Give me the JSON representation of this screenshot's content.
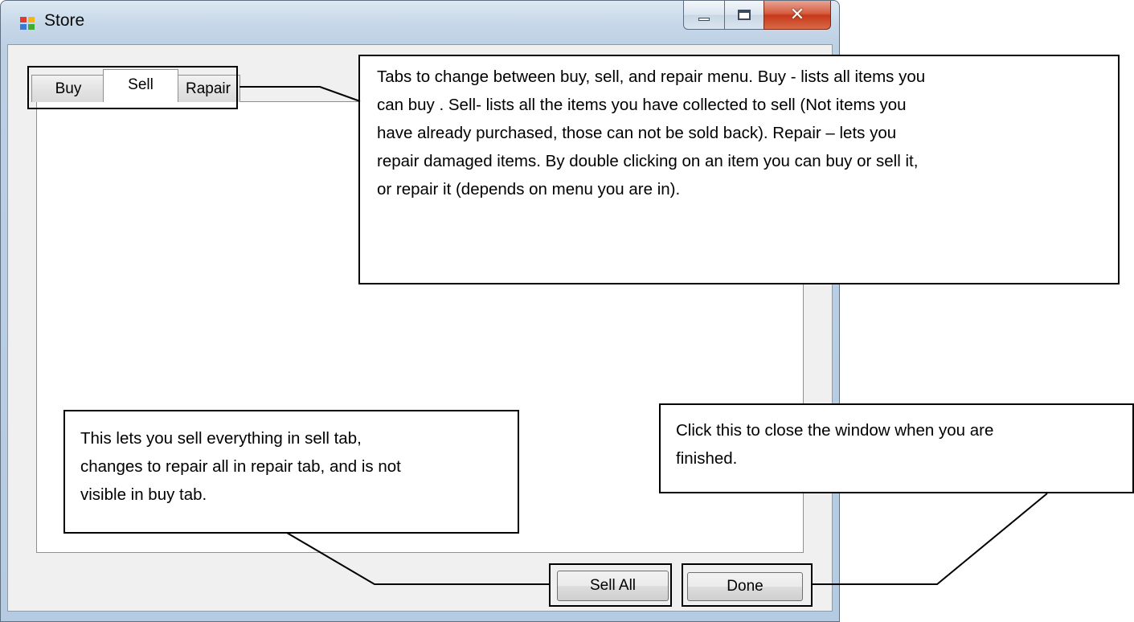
{
  "window": {
    "title": "Store",
    "icon": "store-app-icon",
    "caption_buttons": [
      "minimize-icon",
      "maximize-icon",
      "close-icon"
    ]
  },
  "tabs": [
    {
      "label": "Buy"
    },
    {
      "label": "Sell",
      "selected": true
    },
    {
      "label": "Rapair"
    }
  ],
  "buttons": {
    "sell_all": "Sell All",
    "done": "Done"
  },
  "callouts": {
    "tabs": [
      "Tabs to change between buy, sell, and repair menu. Buy - lists all items you",
      "can buy . Sell- lists all the items you have collected to sell (Not items you",
      "have already purchased, those can not be sold back). Repair – lets you",
      "repair damaged items. By double clicking on an item you can buy or sell it,",
      "or repair it (depends on menu you are in)."
    ],
    "sell_all": [
      "This lets you sell everything in sell tab,",
      "changes to repair all in repair tab, and is not",
      "visible in buy tab."
    ],
    "done": [
      "Click this to close the window when you are",
      "finished."
    ]
  }
}
